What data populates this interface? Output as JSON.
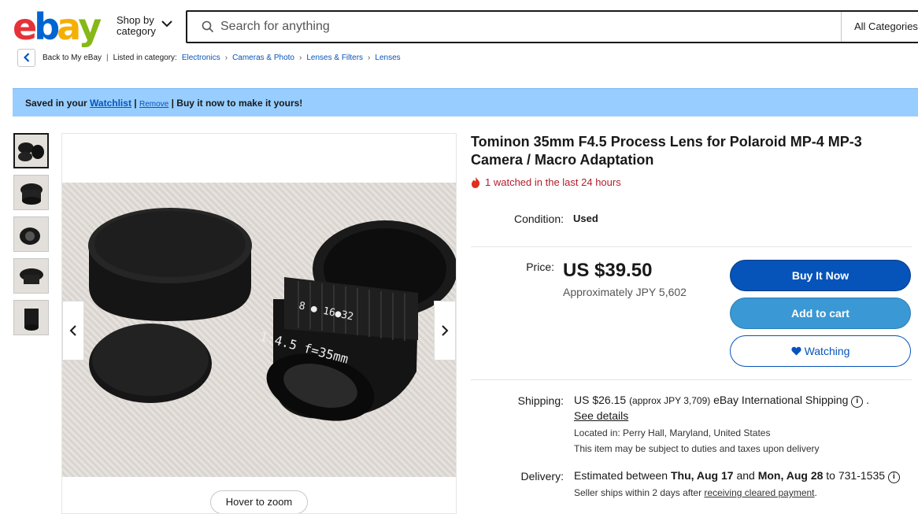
{
  "header": {
    "logo_letters": [
      "e",
      "b",
      "a",
      "y"
    ],
    "logo_colors": [
      "#e53238",
      "#0064d2",
      "#f5af02",
      "#86b817"
    ],
    "shop_by_line1": "Shop by",
    "shop_by_line2": "category",
    "search_placeholder": "Search for anything",
    "all_categories": "All Categories"
  },
  "breadcrumb": {
    "back": "Back to My eBay",
    "listed_in": "Listed in category:",
    "items": [
      "Electronics",
      "Cameras & Photo",
      "Lenses & Filters",
      "Lenses"
    ]
  },
  "banner": {
    "saved_in": "Saved in your",
    "watchlist": "Watchlist",
    "sep": "|",
    "remove": "Remove",
    "message": "| Buy it now to make it yours!"
  },
  "gallery": {
    "thumbnail_count": 5,
    "hover_zoom": "Hover to zoom"
  },
  "listing": {
    "title": "Tominon 35mm F4.5 Process Lens for Polaroid MP-4 MP-3 Camera / Macro Adaptation",
    "watched": "1 watched in the last 24 hours",
    "condition_label": "Condition:",
    "condition_value": "Used",
    "price_label": "Price:",
    "price": "US $39.50",
    "approx_price": "Approximately JPY 5,602",
    "buy_now": "Buy It Now",
    "add_to_cart": "Add to cart",
    "watching": "Watching"
  },
  "shipping": {
    "label": "Shipping:",
    "cost": "US $26.15",
    "approx": "(approx JPY 3,709)",
    "method": "eBay International Shipping",
    "period": ".",
    "see_details": "See details",
    "located": "Located in: Perry Hall, Maryland, United States",
    "duties": "This item may be subject to duties and taxes upon delivery"
  },
  "delivery": {
    "label": "Delivery:",
    "estimated": "Estimated between",
    "date_from": "Thu, Aug 17",
    "and": "and",
    "date_to": "Mon, Aug 28",
    "to_zip": "to 731-1535",
    "seller_ships": "Seller ships within 2 days after",
    "receiving": "receiving cleared payment",
    "period": "."
  },
  "colors": {
    "buy_now": "#0654ba",
    "add_to_cart": "#3a98d4",
    "banner": "#98ceff",
    "watched_red": "#b21e2d"
  }
}
